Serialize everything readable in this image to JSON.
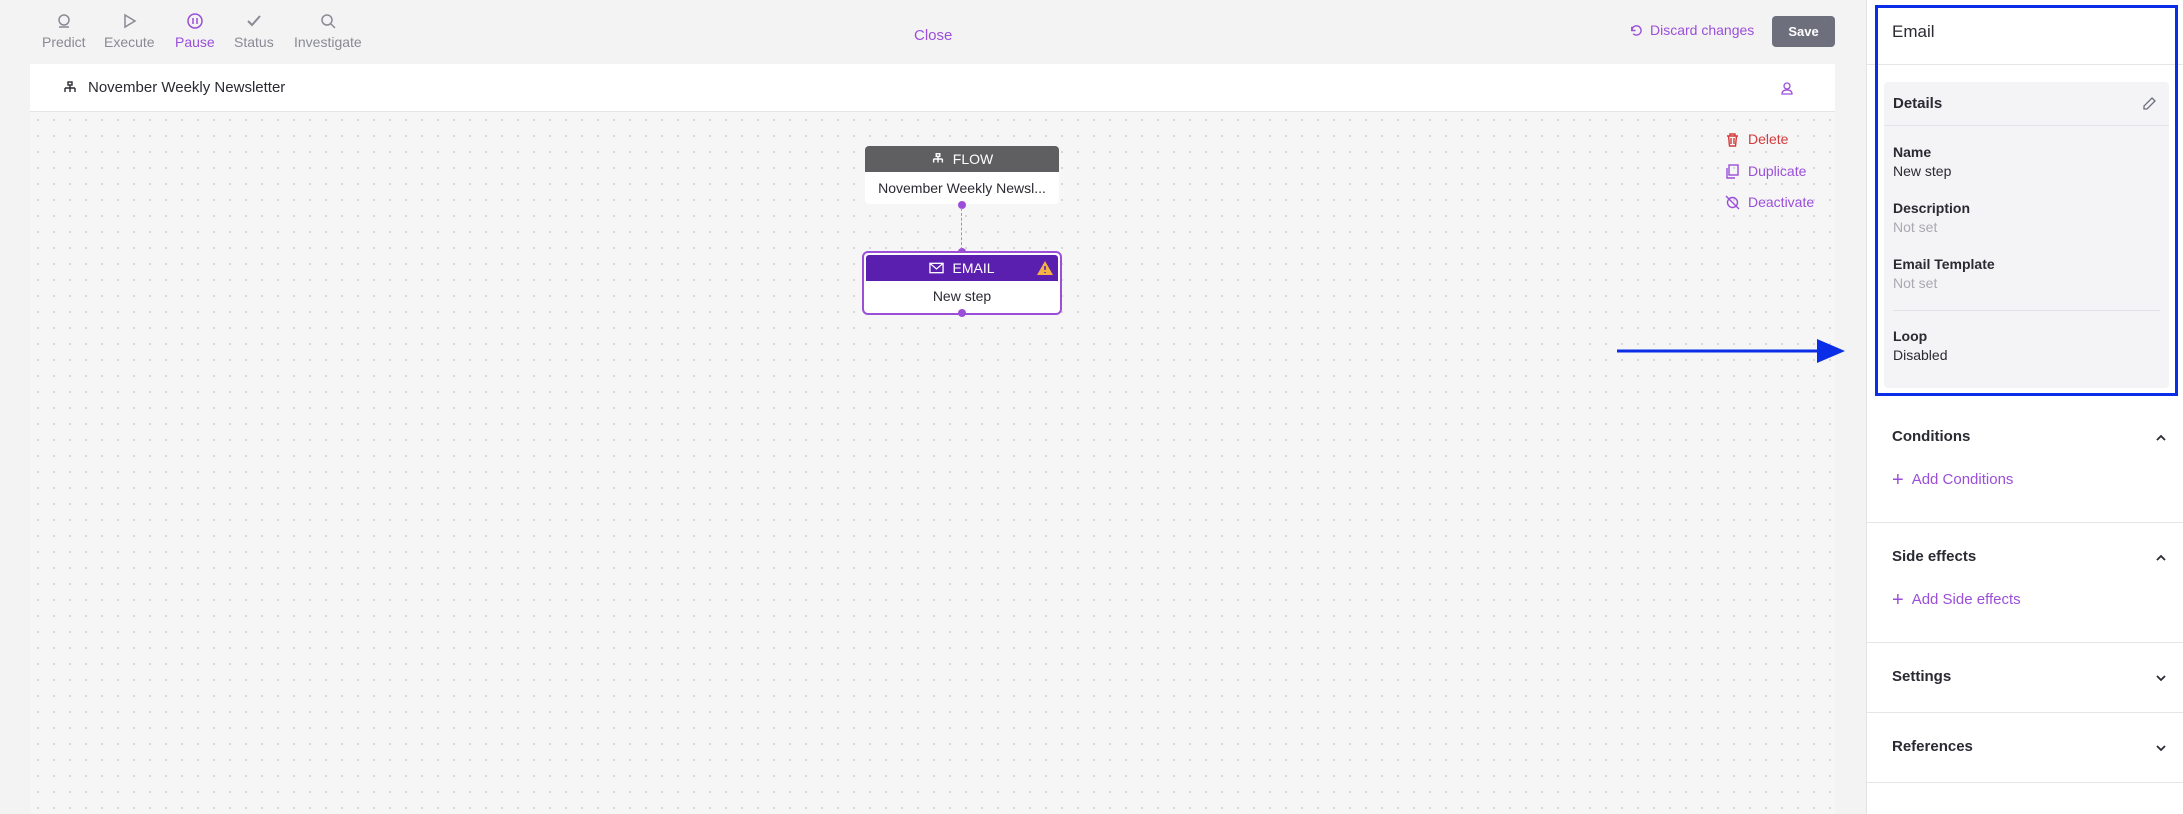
{
  "toolbar": {
    "tools": [
      {
        "label": "Predict",
        "icon": "predict-icon"
      },
      {
        "label": "Execute",
        "icon": "play-icon"
      },
      {
        "label": "Pause",
        "icon": "pause-icon",
        "active": true
      },
      {
        "label": "Status",
        "icon": "check-icon"
      },
      {
        "label": "Investigate",
        "icon": "search-icon"
      }
    ],
    "close_label": "Close",
    "discard_label": "Discard changes",
    "save_label": "Save"
  },
  "canvas": {
    "flow_name": "November Weekly Newsletter",
    "nodes": {
      "flow": {
        "type_label": "FLOW",
        "name": "November Weekly Newsl..."
      },
      "email": {
        "type_label": "EMAIL",
        "name": "New step"
      }
    },
    "actions": {
      "delete": "Delete",
      "duplicate": "Duplicate",
      "deactivate": "Deactivate"
    }
  },
  "panel": {
    "title": "Email",
    "details": {
      "heading": "Details",
      "fields": [
        {
          "label": "Name",
          "value": "New step"
        },
        {
          "label": "Description",
          "value": "Not set"
        },
        {
          "label": "Email Template",
          "value": "Not set"
        },
        {
          "label": "Loop",
          "value": "Disabled"
        }
      ]
    },
    "sections": {
      "conditions": {
        "heading": "Conditions",
        "add_label": "Add Conditions"
      },
      "side_effects": {
        "heading": "Side effects",
        "add_label": "Add Side effects"
      },
      "settings": {
        "heading": "Settings"
      },
      "references": {
        "heading": "References"
      }
    }
  },
  "colors": {
    "accent": "#9b4fd9",
    "email_header": "#5b1fb0",
    "flow_header": "#5f5f62",
    "highlight": "#0a2ee8",
    "delete": "#d43b3b"
  }
}
